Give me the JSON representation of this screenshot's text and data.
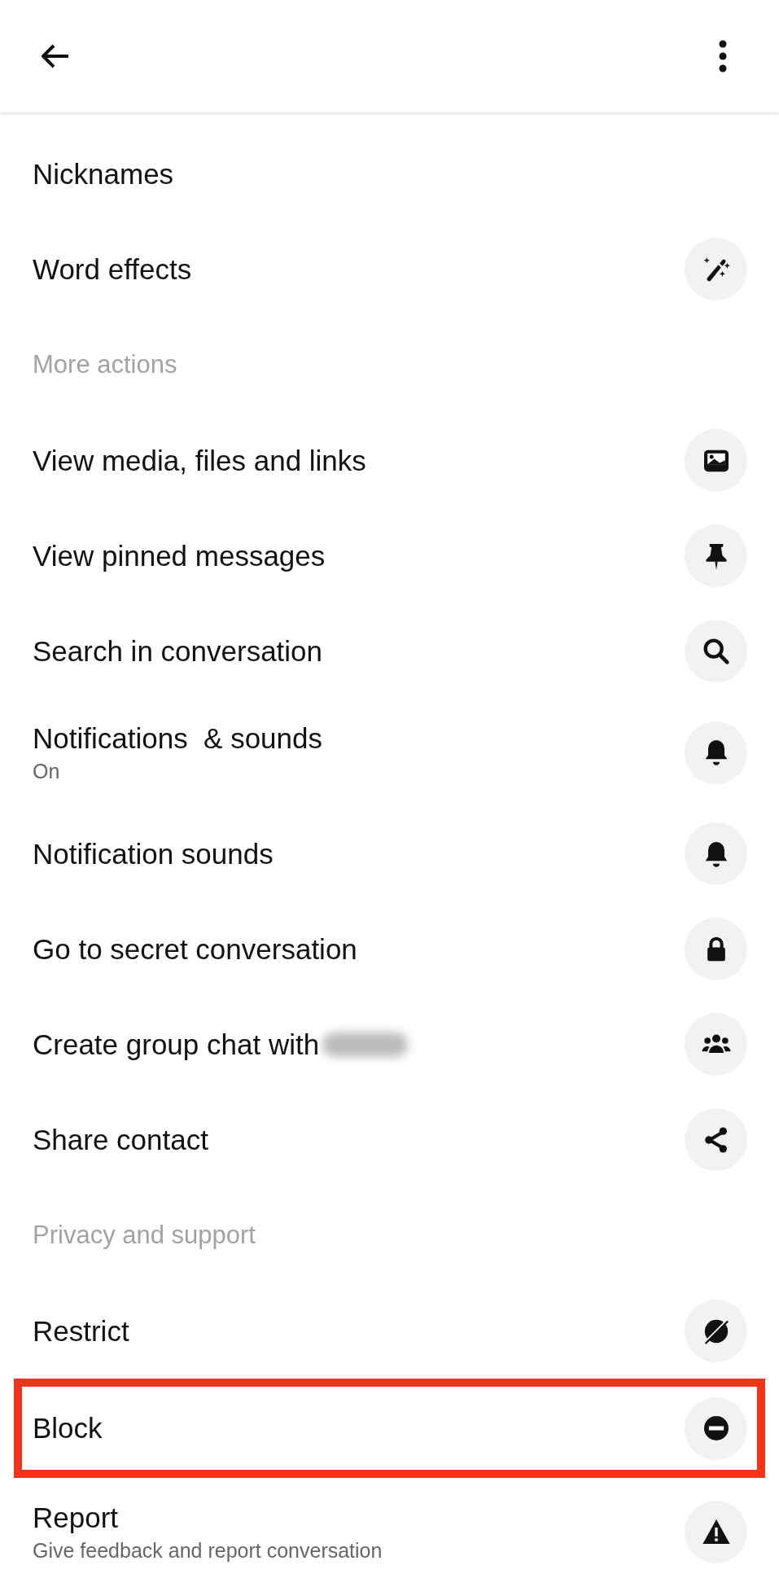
{
  "items": [
    {
      "kind": "row",
      "label": "Nicknames"
    },
    {
      "kind": "row",
      "label": "Word effects"
    },
    {
      "kind": "section",
      "label": "More actions"
    },
    {
      "kind": "row",
      "label": "View media, files and links"
    },
    {
      "kind": "row",
      "label": "View pinned messages"
    },
    {
      "kind": "row",
      "label": "Search in conversation"
    },
    {
      "kind": "row",
      "label": "Notifications  & sounds",
      "sublabel": "On"
    },
    {
      "kind": "row",
      "label": "Notification sounds"
    },
    {
      "kind": "row",
      "label": "Go to secret conversation"
    },
    {
      "kind": "row",
      "label": "Create group chat with",
      "redacted": true
    },
    {
      "kind": "row",
      "label": "Share contact"
    },
    {
      "kind": "section",
      "label": "Privacy and support"
    },
    {
      "kind": "row",
      "label": "Restrict"
    },
    {
      "kind": "row",
      "label": "Block",
      "highlighted": true
    },
    {
      "kind": "row",
      "label": "Report",
      "sublabel": "Give feedback and report conversation"
    }
  ]
}
